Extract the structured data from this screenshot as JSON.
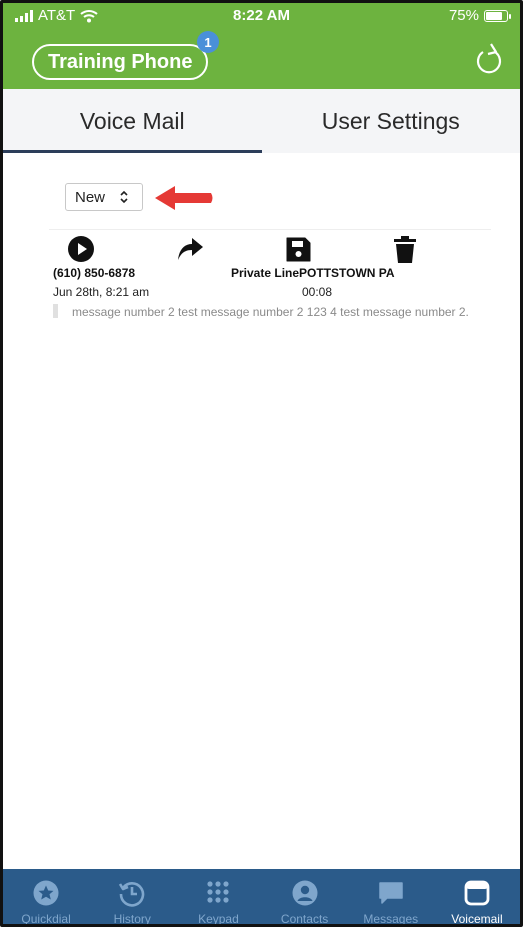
{
  "status_bar": {
    "carrier": "AT&T",
    "time": "8:22 AM",
    "battery": "75%"
  },
  "header": {
    "phone_label": "Training Phone",
    "badge_count": "1",
    "refresh_icon": "refresh-icon",
    "color": "#6db33f"
  },
  "tabs": [
    {
      "label": "Voice Mail",
      "active": true
    },
    {
      "label": "User Settings",
      "active": false
    }
  ],
  "filter": {
    "selected": "New"
  },
  "voicemail": {
    "actions": [
      "play-icon",
      "forward-icon",
      "save-icon",
      "trash-icon"
    ],
    "number": "(610) 850-6878",
    "date": "Jun 28th, 8:21 am",
    "caller": "Private LinePOTTSTOWN PA",
    "duration": "00:08",
    "transcription": "message number 2 test message number 2 123 4 test message number 2."
  },
  "bottom_nav": [
    {
      "label": "Quickdial",
      "icon": "star-icon",
      "active": false
    },
    {
      "label": "History",
      "icon": "history-icon",
      "active": false
    },
    {
      "label": "Keypad",
      "icon": "keypad-icon",
      "active": false
    },
    {
      "label": "Contacts",
      "icon": "contact-icon",
      "active": false
    },
    {
      "label": "Messages",
      "icon": "message-icon",
      "active": false
    },
    {
      "label": "Voicemail",
      "icon": "voicemail-icon",
      "active": true
    }
  ],
  "colors": {
    "accent": "#6db33f",
    "nav_bg": "#2b5b8a",
    "tab_underline": "#2c3e5a",
    "arrow": "#e53935"
  }
}
